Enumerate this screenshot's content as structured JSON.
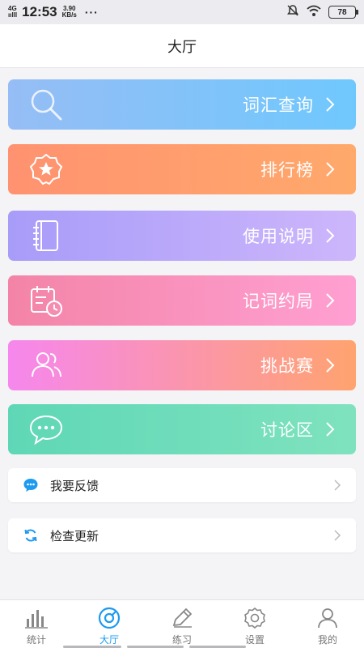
{
  "status_bar": {
    "network_top": "4G",
    "network_bottom": "ıılll",
    "time": "12:53",
    "speed_value": "3.90",
    "speed_unit": "KB/s",
    "more": "···",
    "battery": "78"
  },
  "header": {
    "title": "大厅"
  },
  "menu": [
    {
      "label": "词汇查询",
      "icon": "search-icon"
    },
    {
      "label": "排行榜",
      "icon": "star-badge-icon"
    },
    {
      "label": "使用说明",
      "icon": "notebook-icon"
    },
    {
      "label": "记词约局",
      "icon": "calendar-clock-icon"
    },
    {
      "label": "挑战赛",
      "icon": "users-icon"
    },
    {
      "label": "讨论区",
      "icon": "chat-bubble-icon"
    }
  ],
  "list_rows": [
    {
      "label": "我要反馈",
      "icon": "feedback-icon"
    },
    {
      "label": "检查更新",
      "icon": "refresh-icon"
    }
  ],
  "tabs": [
    {
      "label": "统计",
      "icon": "stats-icon"
    },
    {
      "label": "大厅",
      "icon": "hall-icon",
      "active": true
    },
    {
      "label": "练习",
      "icon": "pencil-icon"
    },
    {
      "label": "设置",
      "icon": "gear-icon"
    },
    {
      "label": "我的",
      "icon": "profile-icon"
    }
  ],
  "colors": {
    "accent": "#1e9af0",
    "search_gradient": [
      "#96bdf5",
      "#6fc8fd"
    ],
    "rank_gradient": [
      "#ff9270",
      "#ffa96b"
    ],
    "manual_gradient": [
      "#a89cf9",
      "#cdb6fb"
    ],
    "appoint_gradient": [
      "#f384a7",
      "#ffa0d2"
    ],
    "challenge_gradient": [
      "#f687ed",
      "#ffa36f"
    ],
    "forum_gradient": [
      "#5fd7b6",
      "#7fe2be"
    ]
  }
}
